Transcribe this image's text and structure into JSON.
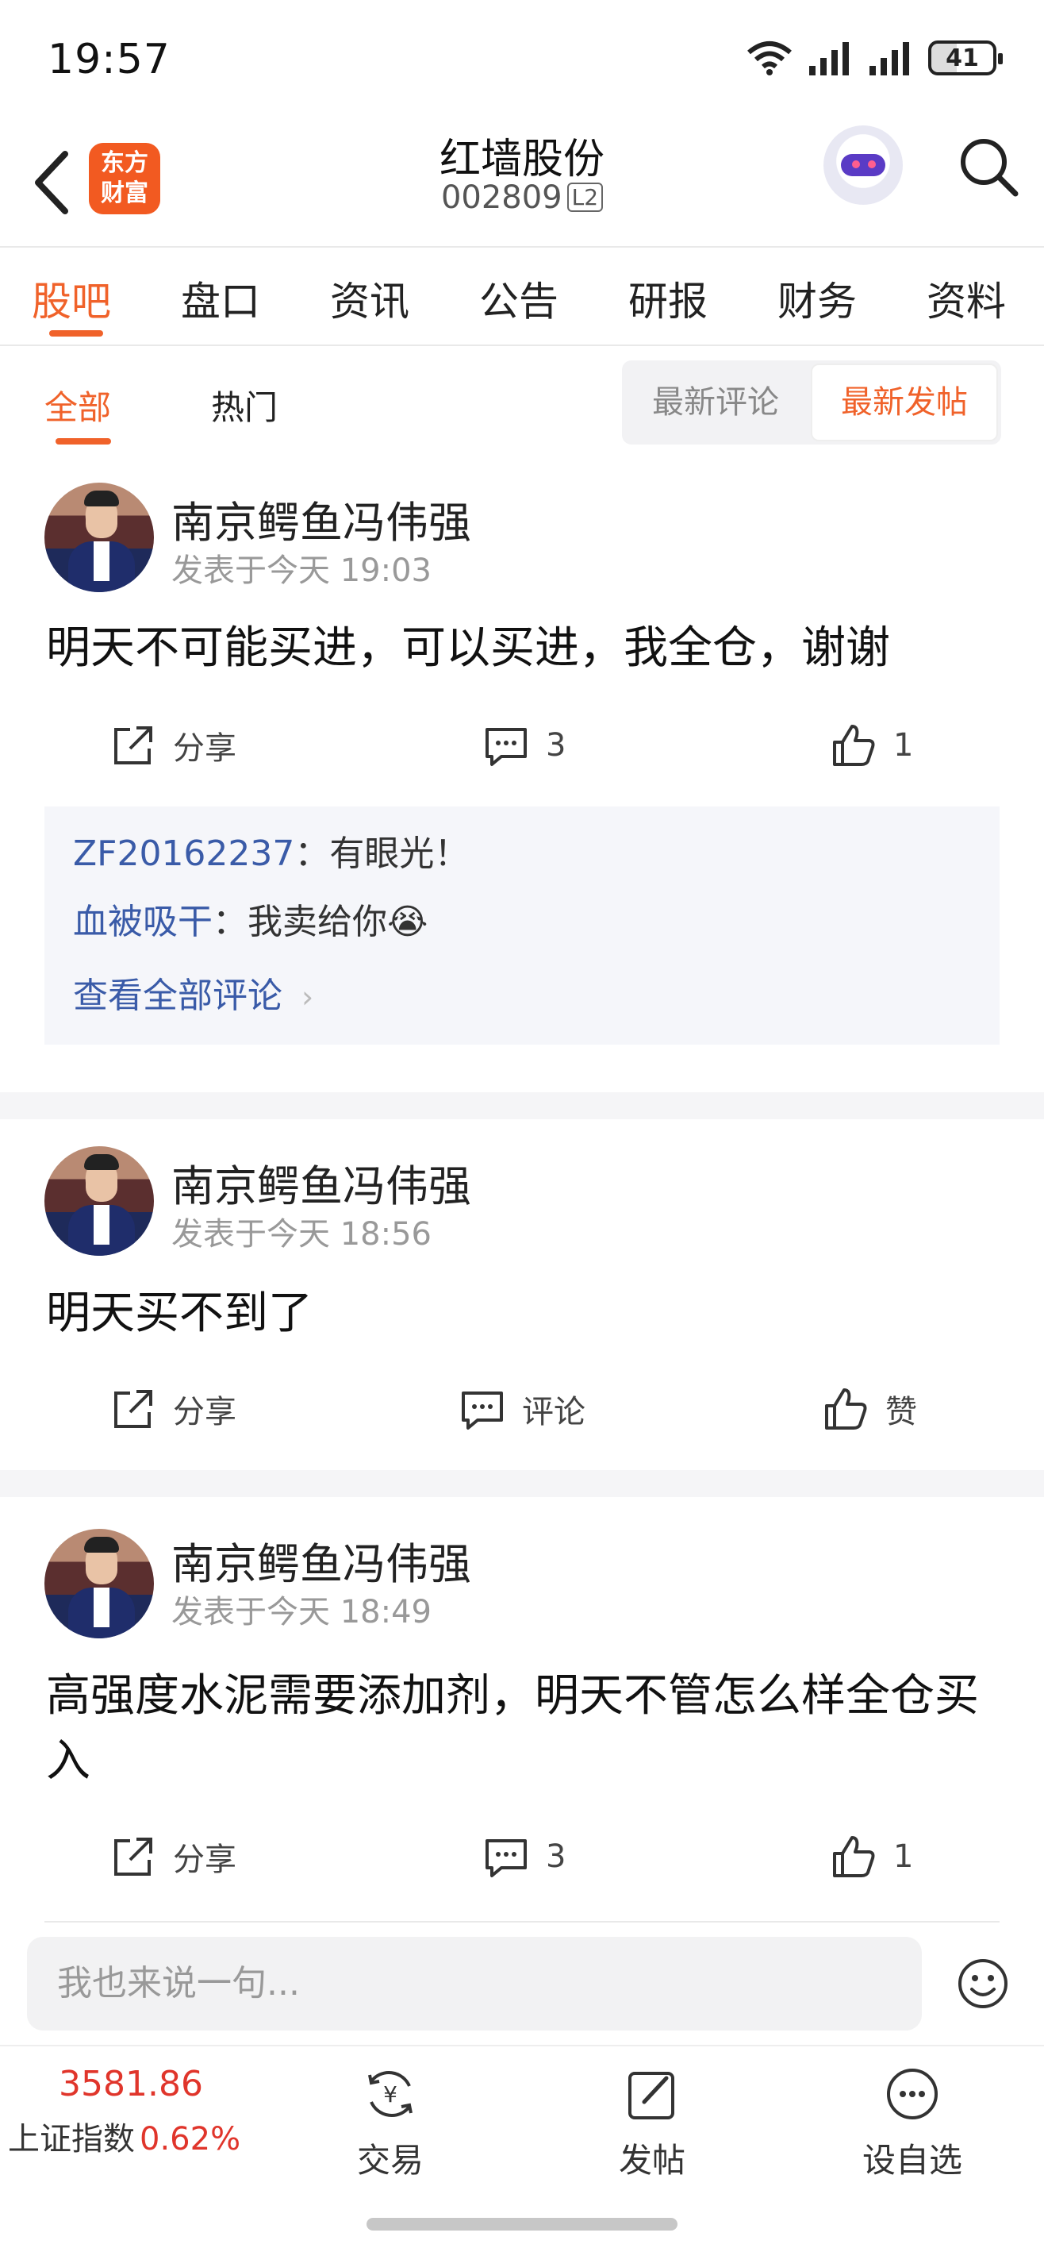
{
  "status": {
    "time": "19:57",
    "battery": "41"
  },
  "header": {
    "logo_line1": "东方",
    "logo_line2": "财富",
    "stock_name": "红墙股份",
    "stock_code": "002809",
    "level_badge": "L2"
  },
  "tabs": [
    "股吧",
    "盘口",
    "资讯",
    "公告",
    "研报",
    "财务",
    "资料"
  ],
  "subtabs": {
    "all": "全部",
    "hot": "热门",
    "sort_latest_comment": "最新评论",
    "sort_latest_post": "最新发帖"
  },
  "posts": [
    {
      "author": "南京鳄鱼冯伟强",
      "time": "发表于今天 19:03",
      "content": "明天不可能买进，可以买进，我全仓，谢谢",
      "share": "分享",
      "comments": "3",
      "likes": "1",
      "replies": [
        {
          "user": "ZF20162237",
          "sep": "：",
          "text": "有眼光！"
        },
        {
          "user": "血被吸干",
          "sep": "：",
          "text": "我卖给你😭"
        }
      ],
      "view_all": "查看全部评论"
    },
    {
      "author": "南京鳄鱼冯伟强",
      "time": "发表于今天 18:56",
      "content": "明天买不到了",
      "share": "分享",
      "comments": "评论",
      "likes": "赞"
    },
    {
      "author": "南京鳄鱼冯伟强",
      "time": "发表于今天 18:49",
      "content": "高强度水泥需要添加剂，明天不管怎么样全仓买入",
      "share": "分享",
      "comments": "3",
      "likes": "1"
    }
  ],
  "input": {
    "placeholder": "我也来说一句..."
  },
  "bottom": {
    "index_value": "3581.86",
    "index_name": "上证指数",
    "index_change": "0.62%",
    "trade": "交易",
    "post": "发帖",
    "watchlist": "设自选"
  },
  "colors": {
    "accent": "#f0622a",
    "up": "#e0352b",
    "link": "#3a5ba8"
  }
}
